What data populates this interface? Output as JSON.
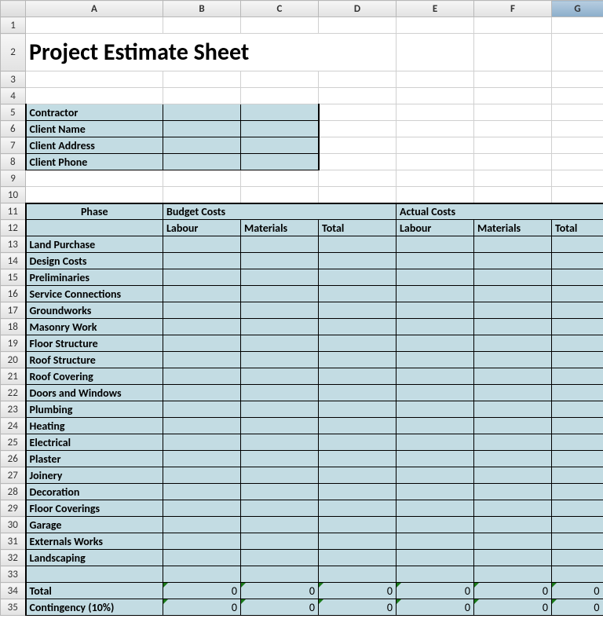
{
  "columns": [
    "A",
    "B",
    "C",
    "D",
    "E",
    "F",
    "G"
  ],
  "title": "Project Estimate Sheet",
  "info": {
    "rows": [
      {
        "row": 5,
        "label": "Contractor"
      },
      {
        "row": 6,
        "label": "Client Name"
      },
      {
        "row": 7,
        "label": "Client Address"
      },
      {
        "row": 8,
        "label": "Client Phone"
      }
    ]
  },
  "headers": {
    "phase": "Phase",
    "budget": "Budget Costs",
    "actual": "Actual Costs",
    "labour": "Labour",
    "materials": "Materials",
    "total": "Total"
  },
  "phases": [
    "Land Purchase",
    "Design Costs",
    "Preliminaries",
    "Service Connections",
    "Groundworks",
    "Masonry Work",
    "Floor Structure",
    "Roof Structure",
    "Roof Covering",
    "Doors and Windows",
    "Plumbing",
    "Heating",
    "Electrical",
    "Plaster",
    "Joinery",
    "Decoration",
    "Floor Coverings",
    "Garage",
    "Externals Works",
    "Landscaping"
  ],
  "totals": {
    "total_label": "Total",
    "contingency_label": "Contingency (10%)",
    "total_values": [
      "0",
      "0",
      "0",
      "0",
      "0",
      "0"
    ],
    "contingency_values": [
      "0",
      "0",
      "0",
      "0",
      "0",
      "0"
    ]
  },
  "colors": {
    "fill": "#c3dce3",
    "grid": "#d0d0d0",
    "border": "#000000"
  }
}
